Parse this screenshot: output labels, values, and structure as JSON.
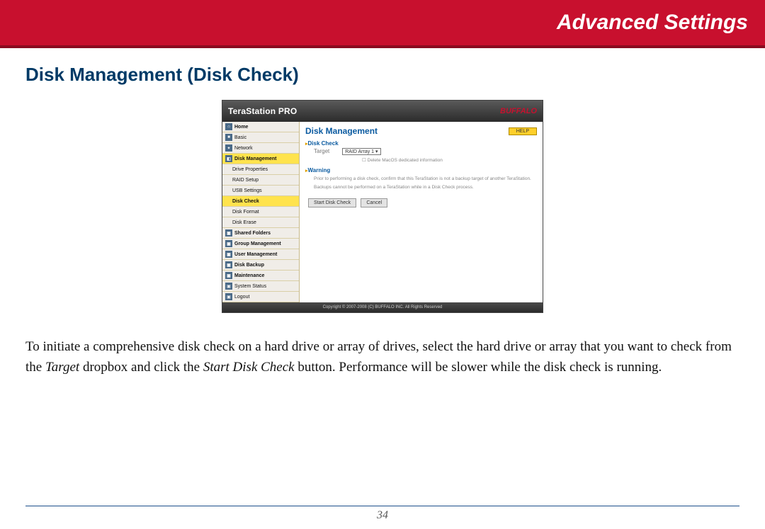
{
  "banner": {
    "title": "Advanced Settings"
  },
  "section": {
    "title": "Disk Management (Disk Check)"
  },
  "screenshot": {
    "logo": "TeraStation PRO",
    "brand": "BUFFALO",
    "nav": {
      "items": [
        {
          "label": "Home",
          "icon": "⌂",
          "bold": true
        },
        {
          "label": "Basic",
          "icon": "■",
          "bold": false
        },
        {
          "label": "Network",
          "icon": "✦",
          "bold": false
        },
        {
          "label": "Disk Management",
          "icon": "◧",
          "bold": true,
          "selected": true
        },
        {
          "label": "Drive Properties",
          "indent": true
        },
        {
          "label": "RAID Setup",
          "indent": true
        },
        {
          "label": "USB Settings",
          "indent": true
        },
        {
          "label": "Disk Check",
          "indent": true,
          "selected": true,
          "bold": true
        },
        {
          "label": "Disk Format",
          "indent": true
        },
        {
          "label": "Disk Erase",
          "indent": true
        },
        {
          "label": "Shared Folders",
          "icon": "▣",
          "bold": true
        },
        {
          "label": "Group Management",
          "icon": "▣",
          "bold": true
        },
        {
          "label": "User Management",
          "icon": "▣",
          "bold": true
        },
        {
          "label": "Disk Backup",
          "icon": "▣",
          "bold": true
        },
        {
          "label": "Maintenance",
          "icon": "▣",
          "bold": true
        },
        {
          "label": "System Status",
          "icon": "▣"
        },
        {
          "label": "Logout",
          "icon": "▣"
        }
      ]
    },
    "content": {
      "title": "Disk Management",
      "help": "HELP",
      "section1": "Disk Check",
      "target_label": "Target",
      "target_value": "RAID Array 1 ▾",
      "checkbox_label": "Delete MacOS dedicated information",
      "section2": "Warning",
      "warn1": "Prior to performing a disk check, confirm that this TeraStation is not a backup target of another TeraStation.",
      "warn2": "Backups cannot be performed on a TeraStation while in a Disk Check process.",
      "btn_start": "Start Disk Check",
      "btn_cancel": "Cancel"
    },
    "footer": "Copyright © 2007-2008 (C) BUFFALO INC. All Rights Reserved"
  },
  "caption": {
    "p1a": "To initiate a comprehensive disk check on a hard drive or array of drives, select the hard drive or array that you want to check from the ",
    "p1b": "Target",
    "p1c": " dropbox and click the ",
    "p1d": "Start Disk Check",
    "p1e": " button. Performance will be slower while the disk check is running."
  },
  "page_number": "34"
}
